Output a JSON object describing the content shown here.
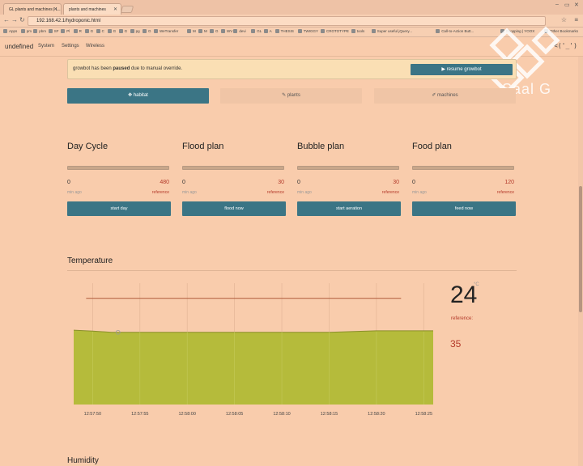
{
  "browser": {
    "tabs": [
      {
        "title": "GL plants and machines | L..."
      },
      {
        "title": "plants and machines"
      }
    ],
    "url": "192.168.42.1/hydroponic.html",
    "bookmarks": [
      "Apps",
      "pm",
      "pbm",
      "SF",
      "Pl",
      "R",
      "G",
      "C",
      "G",
      "G",
      "pg",
      "G",
      "WeTransfer",
      "M",
      "M",
      "G",
      "WV",
      "devi",
      "GL",
      "A",
      "THESIS",
      "TWIGGY",
      "CROTOTYPE",
      "tools",
      "Super useful jQuery...",
      "Call-to-Action Butt...",
      "Shopping | YOOX",
      "Other Bookmarks"
    ]
  },
  "app": {
    "brand": "undefined",
    "nav": [
      "System",
      "Settings",
      "Wireless"
    ],
    "face": "<('_')"
  },
  "alert": {
    "prefix": "growbot has been ",
    "bold": "paused",
    "suffix": " due to manual override.",
    "button": "▶  resume growbot"
  },
  "tabs": {
    "habitat": "✥ habitat",
    "plants": "✎ plants",
    "machines": "✐ machines"
  },
  "cycles": [
    {
      "title": "Day Cycle",
      "value": "0",
      "reference": "480",
      "sub_left": "min ago",
      "sub_right": "reference",
      "button": "start day"
    },
    {
      "title": "Flood plan",
      "value": "0",
      "reference": "30",
      "sub_left": "min ago",
      "sub_right": "reference",
      "button": "flood now"
    },
    {
      "title": "Bubble plan",
      "value": "0",
      "reference": "30",
      "sub_left": "min ago",
      "sub_right": "reference",
      "button": "start aeration"
    },
    {
      "title": "Food plan",
      "value": "0",
      "reference": "120",
      "sub_left": "min ago",
      "sub_right": "reference",
      "button": "feed now"
    }
  ],
  "temperature": {
    "title": "Temperature",
    "current": "24",
    "unit": "°C",
    "reference_label": "reference:",
    "reference": "35"
  },
  "humidity": {
    "title": "Humidity"
  },
  "watermark": "Saal G",
  "colors": {
    "background": "#f9ccac",
    "primary_button": "#3b7585",
    "area_fill": "#b5bb3b",
    "reference_line": "#b05a3a",
    "reference_text": "#b43a2a"
  },
  "chart_data": {
    "type": "area",
    "x": [
      "12:57:48",
      "12:57:50",
      "12:57:52",
      "12:57:55",
      "12:58:00",
      "12:58:05",
      "12:58:10",
      "12:58:15",
      "12:58:18",
      "12:58:20",
      "12:58:25",
      "12:58:26"
    ],
    "x_ticks": [
      "12:57:50",
      "12:57:55",
      "12:58:00",
      "12:58:05",
      "12:58:10",
      "12:58:15",
      "12:58:20",
      "12:58:25"
    ],
    "values": [
      24.5,
      24.2,
      23.8,
      23.8,
      23.8,
      23.8,
      23.8,
      23.8,
      24.1,
      24.3,
      24.3,
      24.3
    ],
    "reference_line": 35,
    "ylim": [
      0,
      40
    ],
    "grid": true
  }
}
